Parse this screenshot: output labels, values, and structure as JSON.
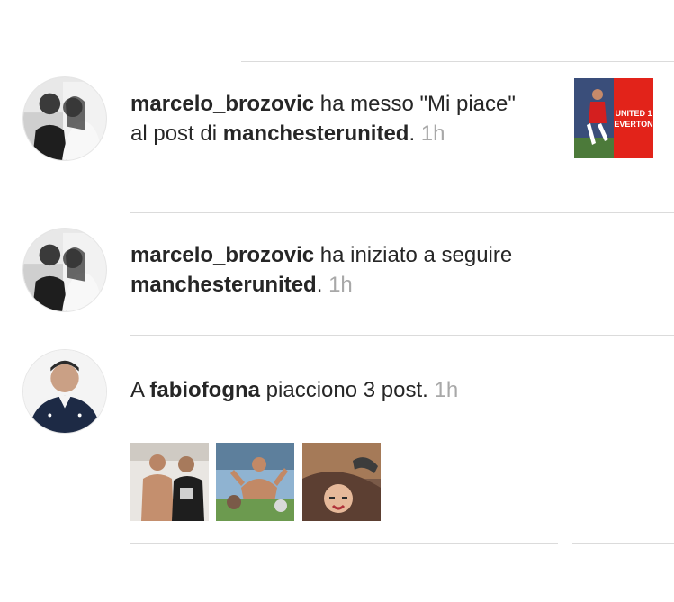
{
  "notifications": [
    {
      "user": "marcelo_brozovic",
      "action": " ha messo \"Mi piace\" al post di ",
      "target": "manchesterunited",
      "suffix": ". ",
      "time": "1h",
      "avatar": "user-photo-avatar",
      "post_thumbnail": {
        "text_line1": "UNITED 1",
        "text_line2": "EVERTON",
        "accent": "#e2231a"
      }
    },
    {
      "user": "marcelo_brozovic",
      "action": " ha iniziato a seguire ",
      "target": "manchesterunited",
      "suffix": ". ",
      "time": "1h",
      "avatar": "user-photo-avatar"
    },
    {
      "prefix": "A ",
      "user": "fabiofogna",
      "action": " piacciono 3 post. ",
      "time": "1h",
      "avatar": "user-photo-avatar",
      "liked_posts": [
        "post-thumbnail-1",
        "post-thumbnail-2",
        "post-thumbnail-3"
      ]
    }
  ],
  "colors": {
    "text": "#262626",
    "muted": "#a8a8a8",
    "divider": "#dbdbdb"
  }
}
